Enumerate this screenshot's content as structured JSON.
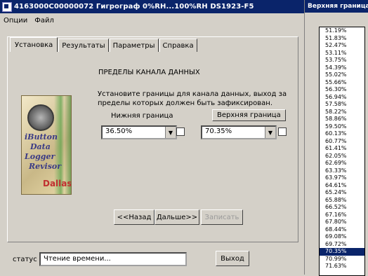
{
  "window": {
    "title": "4163000C00000072   Гигрограф 0%RH...100%RH   DS1923-F5"
  },
  "menu": [
    "Опции",
    "Файл"
  ],
  "tabs": [
    "Установка",
    "Результаты",
    "Параметры",
    "Справка"
  ],
  "setup": {
    "heading": "ПРЕДЕЛЫ КАНАЛА ДАННЫХ",
    "description": "Установите границы для канала данных, выход за пределы которых должен быть зафиксирован.",
    "low_label": "Нижняя граница",
    "high_label": "Верхняя граница",
    "low_value": "36.50%",
    "high_value": "70.35%",
    "book_lines": [
      "iButton",
      "Data",
      "Logger",
      "Revisor"
    ],
    "book_logo": "Dallas"
  },
  "buttons": {
    "back": "<<Назад",
    "next": "Дальше>>",
    "write": "Записать"
  },
  "status": {
    "label": "статус",
    "value": "Чтение времени...",
    "exit": "Выход"
  },
  "popup": {
    "title": "Верхняя граница",
    "items": [
      "51.19%",
      "51.83%",
      "52.47%",
      "53.11%",
      "53.75%",
      "54.39%",
      "55.02%",
      "55.66%",
      "56.30%",
      "56.94%",
      "57.58%",
      "58.22%",
      "58.86%",
      "59.50%",
      "60.13%",
      "60.77%",
      "61.41%",
      "62.05%",
      "62.69%",
      "63.33%",
      "63.97%",
      "64.61%",
      "65.24%",
      "65.88%",
      "66.52%",
      "67.16%",
      "67.80%",
      "68.44%",
      "69.08%",
      "69.72%",
      "70.35%",
      "70.99%",
      "71.63%"
    ],
    "selected": "70.35%"
  }
}
